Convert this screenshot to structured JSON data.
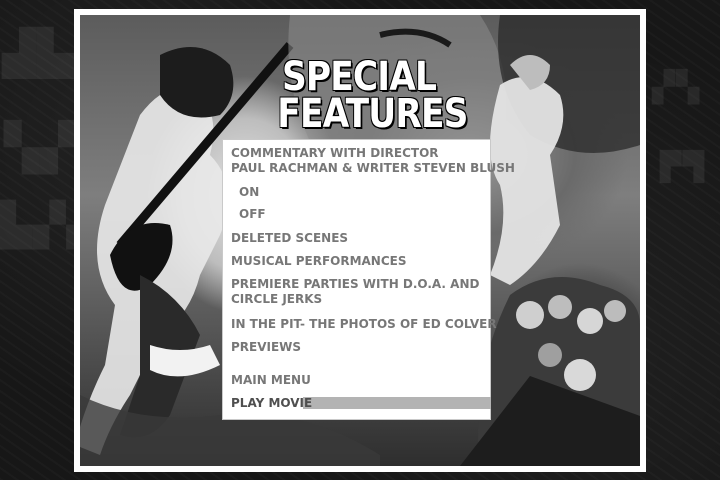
{
  "screen": {
    "title_line1": "SPECIAL",
    "title_line2": "FEATURES"
  },
  "menu": {
    "commentary_line1": "COMMENTARY WITH DIRECTOR",
    "commentary_line2": "PAUL RACHMAN & WRITER STEVEN BLUSH",
    "commentary_on": "ON",
    "commentary_off": "OFF",
    "deleted_scenes": "DELETED SCENES",
    "musical_performances": "MUSICAL PERFORMANCES",
    "premiere_line1": "PREMIERE PARTIES WITH D.O.A. AND",
    "premiere_line2": "CIRCLE JERKS",
    "in_the_pit": "IN THE PIT- THE PHOTOS OF ED COLVER",
    "previews": "PREVIEWS",
    "main_menu": "MAIN MENU",
    "play_movie": "PLAY MOVIE",
    "selected_item": "PLAY MOVIE"
  },
  "colors": {
    "menu_text": "#777777",
    "highlight": "#b3b3b3",
    "frame": "#ffffff",
    "background": "#171717"
  }
}
